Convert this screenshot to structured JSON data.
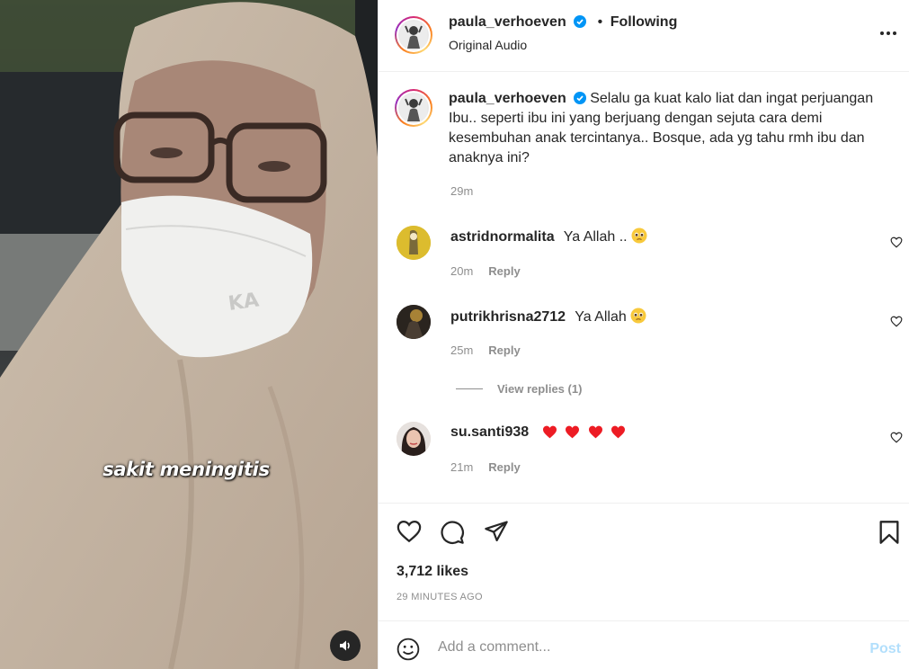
{
  "media": {
    "caption": "sakit meningitis",
    "audio_icon": "speaker-icon"
  },
  "header": {
    "username": "paula_verhoeven",
    "separator": "•",
    "follow_status": "Following",
    "audio_label": "Original Audio",
    "more_icon": "ellipsis-icon"
  },
  "post": {
    "username": "paula_verhoeven",
    "caption": "Selalu ga kuat kalo liat dan ingat perjuangan Ibu.. seperti ibu ini yang berjuang dengan sejuta cara demi kesembuhan anak tercintanya.. Bosque, ada yg tahu rmh ibu dan anaknya ini?",
    "time": "29m"
  },
  "comments": [
    {
      "username": "astridnormalita",
      "text": "Ya Allah ..",
      "emoji": "pleading-face",
      "time": "20m",
      "reply_label": "Reply"
    },
    {
      "username": "putrikhrisna2712",
      "text": "Ya Allah",
      "emoji": "pleading-face",
      "time": "25m",
      "reply_label": "Reply"
    },
    {
      "username": "su.santi938",
      "text": "",
      "emoji": "red-hearts-x4",
      "time": "21m",
      "reply_label": "Reply"
    }
  ],
  "view_replies": "View replies (1)",
  "actions": {
    "likes": "3,712 likes",
    "time_ago": "29 MINUTES AGO"
  },
  "composer": {
    "placeholder": "Add a comment...",
    "post_label": "Post"
  },
  "colors": {
    "text": "#262626",
    "secondary": "#8e8e8e",
    "verified": "#0095f6",
    "post_disabled": "#b2dffc",
    "heart_red": "#ed4956"
  }
}
